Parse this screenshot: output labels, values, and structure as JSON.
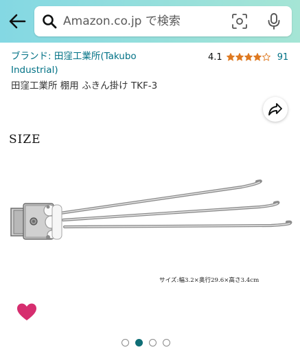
{
  "colors": {
    "header_gradient_start": "#84d8e3",
    "header_gradient_end": "#a5e5d5",
    "link": "#007185",
    "star": "#de7921",
    "heart": "#d62e6f",
    "active_dot": "#0f6e76"
  },
  "header": {
    "back_icon": "arrow-left-icon",
    "search": {
      "placeholder": "Amazon.co.jp で検索",
      "icon": "search-icon",
      "camera_icon": "camera-scan-icon",
      "mic_icon": "microphone-icon"
    }
  },
  "product": {
    "brand_link": "ブランド: 田窪工業所(Takubo Industrial)",
    "rating": {
      "value": "4.1",
      "stars": 4.1,
      "max_stars": 5,
      "count": "91"
    },
    "title": "田窪工業所 棚用 ふきん掛け TKF-3",
    "share_icon": "share-arrow-icon",
    "image": {
      "size_label": "SIZE",
      "spec": "サイズ:幅3.2×奥行29.6×高さ3.4cm"
    },
    "favorite_icon": "heart-icon"
  },
  "carousel": {
    "count": 4,
    "active_index": 1
  }
}
